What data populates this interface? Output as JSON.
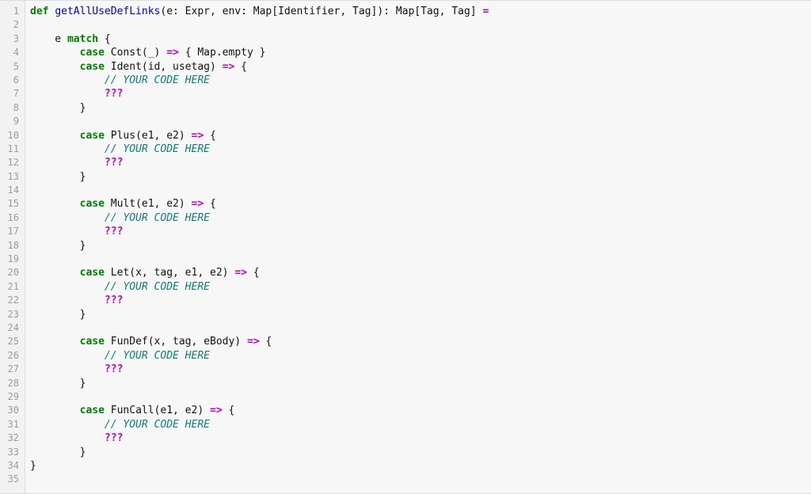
{
  "editor": {
    "language": "scala",
    "gutter_label": "line-numbers",
    "first_line": 1,
    "last_line": 35,
    "total_lines": 35,
    "colors": {
      "background": "#f7f7f7",
      "gutter_background": "#f2f2f2",
      "gutter_text": "#9b9b9b",
      "gutter_border": "#dddddd",
      "plain_text": "#111111",
      "keyword": "#007f00",
      "function_name": "#0000cc",
      "operator": "#c000c0",
      "comment": "#0f7b7b",
      "hole": "#c000c0"
    }
  },
  "line_numbers": [
    "1",
    "2",
    "3",
    "4",
    "5",
    "6",
    "7",
    "8",
    "9",
    "10",
    "11",
    "12",
    "13",
    "14",
    "15",
    "16",
    "17",
    "18",
    "19",
    "20",
    "21",
    "22",
    "23",
    "24",
    "25",
    "26",
    "27",
    "28",
    "29",
    "30",
    "31",
    "32",
    "33",
    "34",
    "35"
  ],
  "code_lines": [
    {
      "n": 1,
      "tokens": [
        {
          "t": "kw",
          "s": "def"
        },
        {
          "t": "plain",
          "s": " "
        },
        {
          "t": "fn",
          "s": "getAllUseDefLinks"
        },
        {
          "t": "plain",
          "s": "(e: Expr, env: Map[Identifier, Tag]): Map[Tag, Tag] "
        },
        {
          "t": "op",
          "s": "="
        }
      ]
    },
    {
      "n": 2,
      "tokens": []
    },
    {
      "n": 3,
      "tokens": [
        {
          "t": "plain",
          "s": "    e "
        },
        {
          "t": "kw",
          "s": "match"
        },
        {
          "t": "plain",
          "s": " {"
        }
      ]
    },
    {
      "n": 4,
      "tokens": [
        {
          "t": "plain",
          "s": "        "
        },
        {
          "t": "kw",
          "s": "case"
        },
        {
          "t": "plain",
          "s": " Const(_) "
        },
        {
          "t": "op",
          "s": "=>"
        },
        {
          "t": "plain",
          "s": " { Map.empty }"
        }
      ]
    },
    {
      "n": 5,
      "tokens": [
        {
          "t": "plain",
          "s": "        "
        },
        {
          "t": "kw",
          "s": "case"
        },
        {
          "t": "plain",
          "s": " Ident(id, usetag) "
        },
        {
          "t": "op",
          "s": "=>"
        },
        {
          "t": "plain",
          "s": " {"
        }
      ]
    },
    {
      "n": 6,
      "tokens": [
        {
          "t": "plain",
          "s": "            "
        },
        {
          "t": "comment",
          "s": "// YOUR CODE HERE"
        }
      ]
    },
    {
      "n": 7,
      "tokens": [
        {
          "t": "plain",
          "s": "            "
        },
        {
          "t": "hole",
          "s": "???"
        }
      ]
    },
    {
      "n": 8,
      "tokens": [
        {
          "t": "plain",
          "s": "        }"
        }
      ]
    },
    {
      "n": 9,
      "tokens": []
    },
    {
      "n": 10,
      "tokens": [
        {
          "t": "plain",
          "s": "        "
        },
        {
          "t": "kw",
          "s": "case"
        },
        {
          "t": "plain",
          "s": " Plus(e1, e2) "
        },
        {
          "t": "op",
          "s": "=>"
        },
        {
          "t": "plain",
          "s": " {"
        }
      ]
    },
    {
      "n": 11,
      "tokens": [
        {
          "t": "plain",
          "s": "            "
        },
        {
          "t": "comment",
          "s": "// YOUR CODE HERE"
        }
      ]
    },
    {
      "n": 12,
      "tokens": [
        {
          "t": "plain",
          "s": "            "
        },
        {
          "t": "hole",
          "s": "???"
        }
      ]
    },
    {
      "n": 13,
      "tokens": [
        {
          "t": "plain",
          "s": "        }"
        }
      ]
    },
    {
      "n": 14,
      "tokens": []
    },
    {
      "n": 15,
      "tokens": [
        {
          "t": "plain",
          "s": "        "
        },
        {
          "t": "kw",
          "s": "case"
        },
        {
          "t": "plain",
          "s": " Mult(e1, e2) "
        },
        {
          "t": "op",
          "s": "=>"
        },
        {
          "t": "plain",
          "s": " {"
        }
      ]
    },
    {
      "n": 16,
      "tokens": [
        {
          "t": "plain",
          "s": "            "
        },
        {
          "t": "comment",
          "s": "// YOUR CODE HERE"
        }
      ]
    },
    {
      "n": 17,
      "tokens": [
        {
          "t": "plain",
          "s": "            "
        },
        {
          "t": "hole",
          "s": "???"
        }
      ]
    },
    {
      "n": 18,
      "tokens": [
        {
          "t": "plain",
          "s": "        }"
        }
      ]
    },
    {
      "n": 19,
      "tokens": []
    },
    {
      "n": 20,
      "tokens": [
        {
          "t": "plain",
          "s": "        "
        },
        {
          "t": "kw",
          "s": "case"
        },
        {
          "t": "plain",
          "s": " Let(x, tag, e1, e2) "
        },
        {
          "t": "op",
          "s": "=>"
        },
        {
          "t": "plain",
          "s": " {"
        }
      ]
    },
    {
      "n": 21,
      "tokens": [
        {
          "t": "plain",
          "s": "            "
        },
        {
          "t": "comment",
          "s": "// YOUR CODE HERE"
        }
      ]
    },
    {
      "n": 22,
      "tokens": [
        {
          "t": "plain",
          "s": "            "
        },
        {
          "t": "hole",
          "s": "???"
        }
      ]
    },
    {
      "n": 23,
      "tokens": [
        {
          "t": "plain",
          "s": "        }"
        }
      ]
    },
    {
      "n": 24,
      "tokens": []
    },
    {
      "n": 25,
      "tokens": [
        {
          "t": "plain",
          "s": "        "
        },
        {
          "t": "kw",
          "s": "case"
        },
        {
          "t": "plain",
          "s": " FunDef(x, tag, eBody) "
        },
        {
          "t": "op",
          "s": "=>"
        },
        {
          "t": "plain",
          "s": " {"
        }
      ]
    },
    {
      "n": 26,
      "tokens": [
        {
          "t": "plain",
          "s": "            "
        },
        {
          "t": "comment",
          "s": "// YOUR CODE HERE"
        }
      ]
    },
    {
      "n": 27,
      "tokens": [
        {
          "t": "plain",
          "s": "            "
        },
        {
          "t": "hole",
          "s": "???"
        }
      ]
    },
    {
      "n": 28,
      "tokens": [
        {
          "t": "plain",
          "s": "        }"
        }
      ]
    },
    {
      "n": 29,
      "tokens": []
    },
    {
      "n": 30,
      "tokens": [
        {
          "t": "plain",
          "s": "        "
        },
        {
          "t": "kw",
          "s": "case"
        },
        {
          "t": "plain",
          "s": " FunCall(e1, e2) "
        },
        {
          "t": "op",
          "s": "=>"
        },
        {
          "t": "plain",
          "s": " {"
        }
      ]
    },
    {
      "n": 31,
      "tokens": [
        {
          "t": "plain",
          "s": "            "
        },
        {
          "t": "comment",
          "s": "// YOUR CODE HERE"
        }
      ]
    },
    {
      "n": 32,
      "tokens": [
        {
          "t": "plain",
          "s": "            "
        },
        {
          "t": "hole",
          "s": "???"
        }
      ]
    },
    {
      "n": 33,
      "tokens": [
        {
          "t": "plain",
          "s": "        }"
        }
      ]
    },
    {
      "n": 34,
      "tokens": [
        {
          "t": "plain",
          "s": "}"
        }
      ]
    },
    {
      "n": 35,
      "tokens": []
    }
  ]
}
